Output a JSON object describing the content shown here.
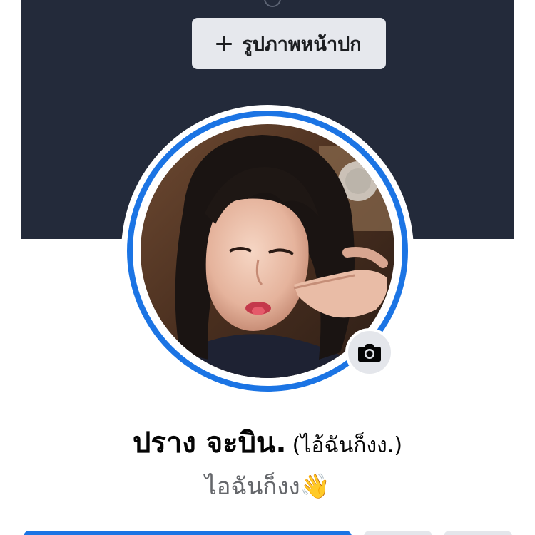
{
  "cover": {
    "add_cover_label": "รูปภาพหน้าปก",
    "background_color": "#232a3a",
    "add_icon": "plus-icon"
  },
  "profile": {
    "name": "ปราง จะบิน.",
    "alternate_name": "(ไอ้ฉันก็งง.)",
    "bio": "ไอฉันก็งง",
    "bio_emoji": "👋",
    "ring_color": "#1b74e4",
    "avatar_icon": "profile-photo",
    "camera_icon": "camera-icon"
  },
  "actions": {
    "primary_color": "#1b74e4",
    "secondary_color": "#e4e6eb"
  }
}
